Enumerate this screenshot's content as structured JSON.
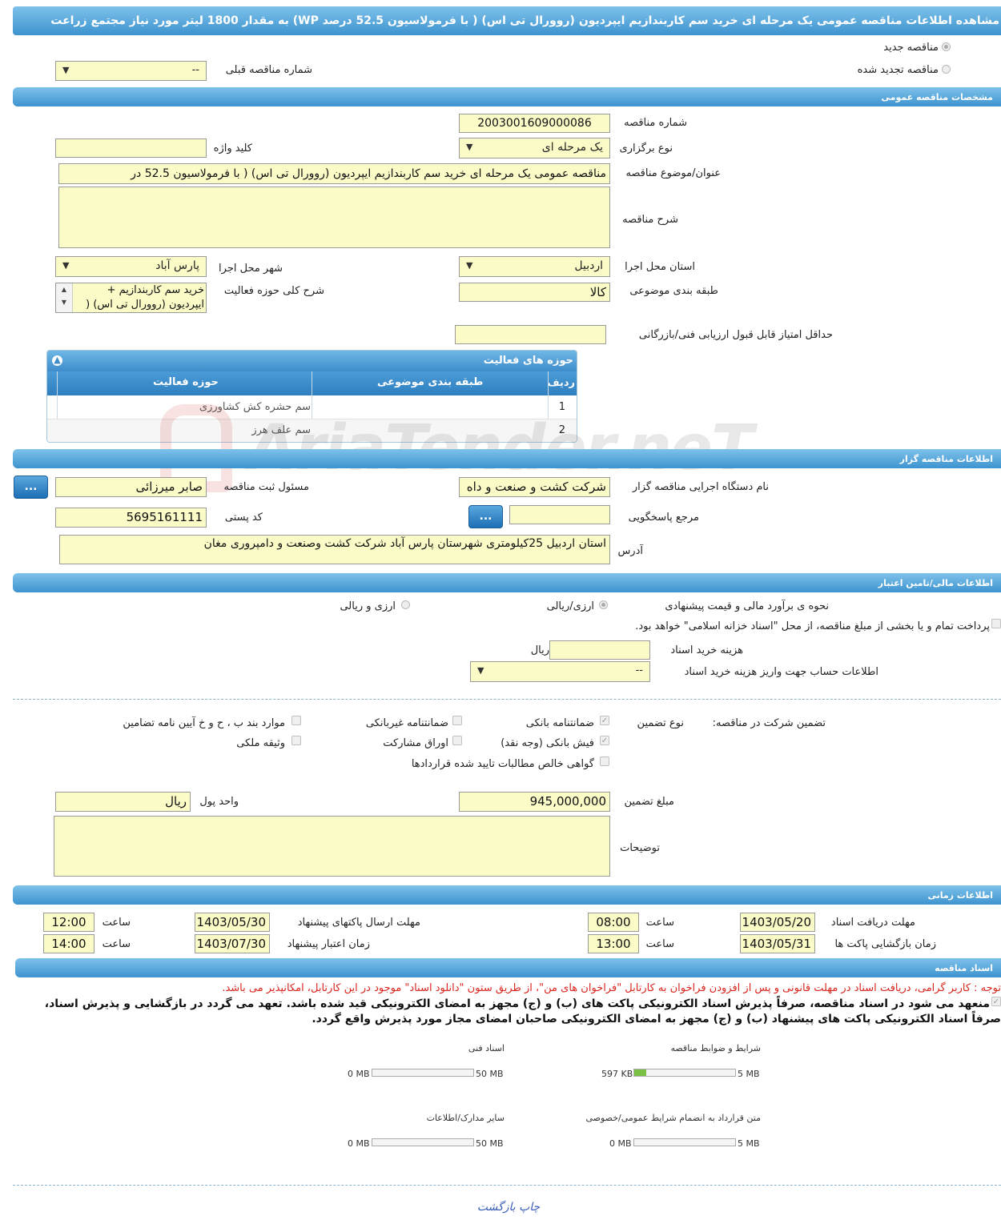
{
  "title": "مشاهده اطلاعات مناقصه عمومی یک مرحله ای خرید سم کاربندازیم ایپردیون (روورال تی اس) ( با فرمولاسیون 52.5 درصد WP) به مقدار 1800 لیتر مورد نیاز مجتمع زراعت",
  "top": {
    "new_tender": "مناقصه جدید",
    "renewed_tender": "مناقصه تجدید شده",
    "prev_number_label": "شماره مناقصه قبلی",
    "prev_number_value": "--"
  },
  "general": {
    "header": "مشخصات مناقصه عمومی",
    "number_label": "شماره مناقصه",
    "number_value": "2003001609000086",
    "keyword_label": "کلید واژه",
    "keyword_value": "",
    "type_label": "نوع برگزاری",
    "type_value": "یک مرحله ای",
    "subject_label": "عنوان/موضوع مناقصه",
    "subject_value": "مناقصه عمومی یک مرحله ای خرید سم کاربندازیم   ایپردیون (روورال تی اس) ( با فرمولاسیون 52.5 در",
    "desc_label": "شرح مناقصه",
    "province_label": "استان محل اجرا",
    "province_value": "اردبیل",
    "city_label": "شهر محل اجرا",
    "city_value": "پارس آباد",
    "category_label": "طبقه بندی موضوعی",
    "category_value": "کالا",
    "scope_label": "شرح کلی حوزه فعالیت",
    "scope_value_1": "خرید سم کاربندازیم +",
    "scope_value_2": "ایپردیون (روورال تی اس) (",
    "min_score_label": "حداقل امتیاز قابل قبول ارزیابی فنی/بازرگانی"
  },
  "activity": {
    "title": "حوزه های فعالیت",
    "col_row": "ردیف",
    "col_category": "طبقه بندی موضوعی",
    "col_scope": "حوزه فعالیت",
    "rows": [
      {
        "n": "1",
        "category": "",
        "scope": "سم حشره کش کشاورزی"
      },
      {
        "n": "2",
        "category": "",
        "scope": "سم علف هرز"
      }
    ]
  },
  "organizer": {
    "header": "اطلاعات مناقصه گزار",
    "org_label": "نام دستگاه اجرایی مناقصه گزار",
    "org_value": "شرکت کشت و صنعت و داه",
    "resp_label": "مسئول ثبت مناقصه",
    "resp_value": "صابر میرزائی",
    "btn": "...",
    "ref_label": "مرجع پاسخگویی",
    "postal_label": "کد پستی",
    "postal_value": "5695161111",
    "address_label": "آدرس",
    "address_value": "استان اردبیل 25کیلومتری شهرستان پارس آباد شرکت کشت وصنعت و دامپروری مغان"
  },
  "finance": {
    "header": "اطلاعات مالی/تامین اعتبار",
    "method_label": "نحوه ی برآورد مالی و قیمت پیشنهادی",
    "opt_rial": "ارزی/ریالی",
    "opt_both": "ارزی و ریالی",
    "treasury_text": "پرداخت تمام و یا بخشی از مبلغ مناقصه، از محل \"اسناد خزانه اسلامی\" خواهد بود.",
    "doc_cost_label": "هزینه خرید اسناد",
    "doc_cost_unit": "ریال",
    "account_label": "اطلاعات حساب جهت واریز هزینه خرید اسناد",
    "account_value": "--"
  },
  "guarantee": {
    "label": "تضمین شرکت در مناقصه:",
    "type_label": "نوع تضمین",
    "bank_guarantee": "ضمانتنامه بانکی",
    "non_bank_guarantee": "ضمانتنامه غیربانکی",
    "clauses": "موارد بند ب ، ح و خ آیین نامه تضامین",
    "bank_receipt": "فیش بانکی (وجه نقد)",
    "bonds": "اوراق مشارکت",
    "property": "وثیقه ملکی",
    "claims": "گواهی خالص مطالبات تایید شده قراردادها",
    "amount_label": "مبلغ تضمین",
    "amount_value": "945,000,000",
    "currency_label": "واحد پول",
    "currency_value": "ریال",
    "notes_label": "توضیحات"
  },
  "timing": {
    "header": "اطلاعات زمانی",
    "doc_receive_label": "مهلت دریافت اسناد",
    "doc_receive_date": "1403/05/20",
    "time_label": "ساعت",
    "doc_receive_time": "08:00",
    "send_label": "مهلت ارسال پاکتهای پیشنهاد",
    "send_date": "1403/05/30",
    "send_time": "12:00",
    "open_label": "زمان بازگشایی پاکت ها",
    "open_date": "1403/05/31",
    "open_time": "13:00",
    "valid_label": "زمان اعتبار پیشنهاد",
    "valid_date": "1403/07/30",
    "valid_time": "14:00"
  },
  "docs": {
    "header": "اسناد مناقصه",
    "notice": "توجه : کاربر گرامی، دریافت اسناد در مهلت قانونی و پس از افزودن فراخوان به کارتابل \"فراخوان های من\"، از طریق ستون \"دانلود اسناد\" موجود در این کارتابل، امکانپذیر می باشد.",
    "commit_1": "منعهد می شود در اسناد مناقصه، صرفاً پذیرش اسناد الکترونیکی پاکت های (ب) و (ج) مجهز به امضای الکترونیکی قید شده باشد. تعهد می گردد در بازگشایی و پذیرش اسناد،",
    "commit_2": "صرفاً اسناد الکترونیکی پاکت های پیشنهاد (ب) و (ج) مجهز به امضای الکترونیکی صاحبان امضای مجاز مورد پذیرش واقع گردد.",
    "items": [
      {
        "title": "شرایط و ضوابط مناقصه",
        "max": "5 MB",
        "used": "597 KB",
        "fill": 0.12
      },
      {
        "title": "اسناد فنی",
        "max": "50 MB",
        "used": "0 MB",
        "fill": 0
      },
      {
        "title": "متن قرارداد به انضمام شرایط عمومی/خصوصی",
        "max": "5 MB",
        "used": "0 MB",
        "fill": 0
      },
      {
        "title": "سایر مدارک/اطلاعات",
        "max": "50 MB",
        "used": "0 MB",
        "fill": 0
      }
    ]
  },
  "footer": {
    "print": "چاپ",
    "back": "بازگشت"
  },
  "colors": {
    "field": "#fbfbc8",
    "header": "#3d93cf",
    "notice": "#d9251d",
    "progress": "#7ac143"
  }
}
